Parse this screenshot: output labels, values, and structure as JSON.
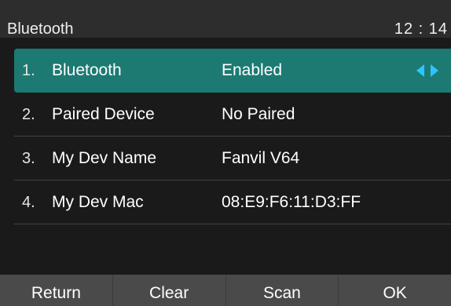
{
  "header": {
    "title": "Bluetooth",
    "time": "12 : 14"
  },
  "items": [
    {
      "index": "1.",
      "label": "Bluetooth",
      "value": "Enabled"
    },
    {
      "index": "2.",
      "label": "Paired Device",
      "value": "No Paired"
    },
    {
      "index": "3.",
      "label": "My Dev Name",
      "value": "Fanvil V64"
    },
    {
      "index": "4.",
      "label": "My Dev Mac",
      "value": "08:E9:F6:11:D3:FF"
    }
  ],
  "softkeys": {
    "return": "Return",
    "clear": "Clear",
    "scan": "Scan",
    "ok": "OK"
  },
  "colors": {
    "selection": "#1c7a72",
    "arrow": "#2ec4ff",
    "softkey_bar": "#4a4a4a"
  },
  "icons": {
    "selector": "left-right-arrows-icon"
  }
}
